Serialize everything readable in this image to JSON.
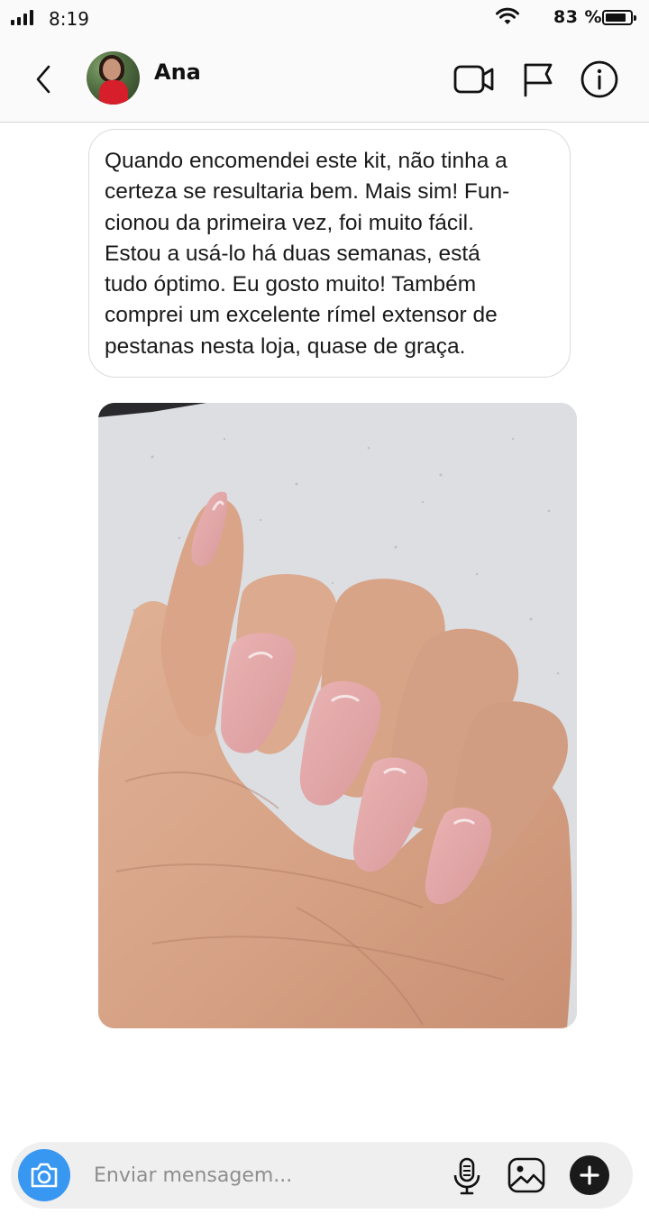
{
  "status_bar": {
    "time": "8:19",
    "battery_percent": "83 %",
    "battery_level": 0.83,
    "icons": [
      "signal-icon",
      "wifi-icon",
      "battery-icon"
    ]
  },
  "header": {
    "contact_name": "Ana",
    "icons": [
      "back-icon",
      "video-call-icon",
      "flag-icon",
      "info-icon"
    ]
  },
  "message": {
    "lines": [
      "Quando encomendei este kit, não tinha a",
      "certeza se resultaria bem. Mais sim! Fun-",
      "cionou da primeira vez, foi muito fácil.",
      "Estou a usá-lo há duas semanas, está",
      "tudo óptimo. Eu gosto muito! Também",
      "comprei um excelente rímel extensor de",
      "pestanas nesta loja, quase de graça."
    ]
  },
  "composer": {
    "placeholder": "Enviar mensagem...",
    "value": "",
    "icons": [
      "camera-icon",
      "microphone-icon",
      "gallery-icon",
      "plus-icon"
    ]
  },
  "colors": {
    "accent": "#3897f0",
    "nail": "#e3a5a6",
    "skin": "#d9a88c"
  }
}
